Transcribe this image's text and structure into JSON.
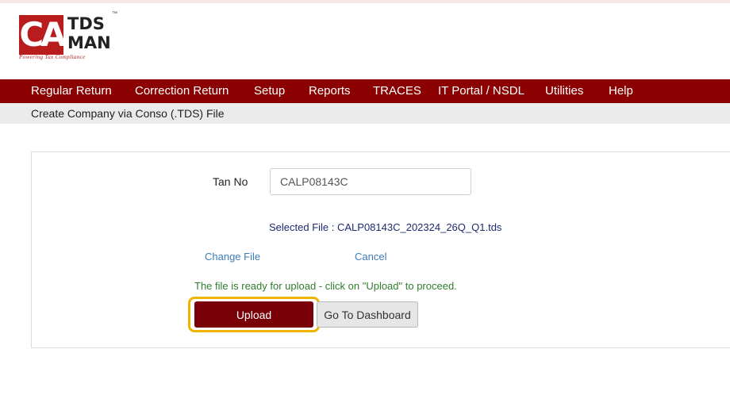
{
  "logo": {
    "ca": "CA",
    "tds": "TDS",
    "man": "MAN",
    "tm": "™",
    "tagline": "Powering Tax Compliance"
  },
  "menu": {
    "items": [
      "Regular Return",
      "Correction Return",
      "Setup",
      "Reports",
      "TRACES",
      "IT Portal / NSDL",
      "Utilities",
      "Help"
    ]
  },
  "page": {
    "title": "Create Company via Conso (.TDS) File"
  },
  "form": {
    "tan_label": "Tan No",
    "tan_value": "CALP08143C",
    "selected_file": "Selected File : CALP08143C_202324_26Q_Q1.tds",
    "change_file": "Change File",
    "cancel": "Cancel",
    "status": "The file is ready for upload - click on \"Upload\" to proceed.",
    "upload": "Upload",
    "go_dashboard": "Go To Dashboard"
  },
  "colors": {
    "brand_red": "#b81c1c",
    "menu_bg": "#8b0000",
    "upload_bg": "#7a0008",
    "highlight": "#f0b400",
    "success_text": "#2f7d2f",
    "link": "#3d7ab8"
  }
}
